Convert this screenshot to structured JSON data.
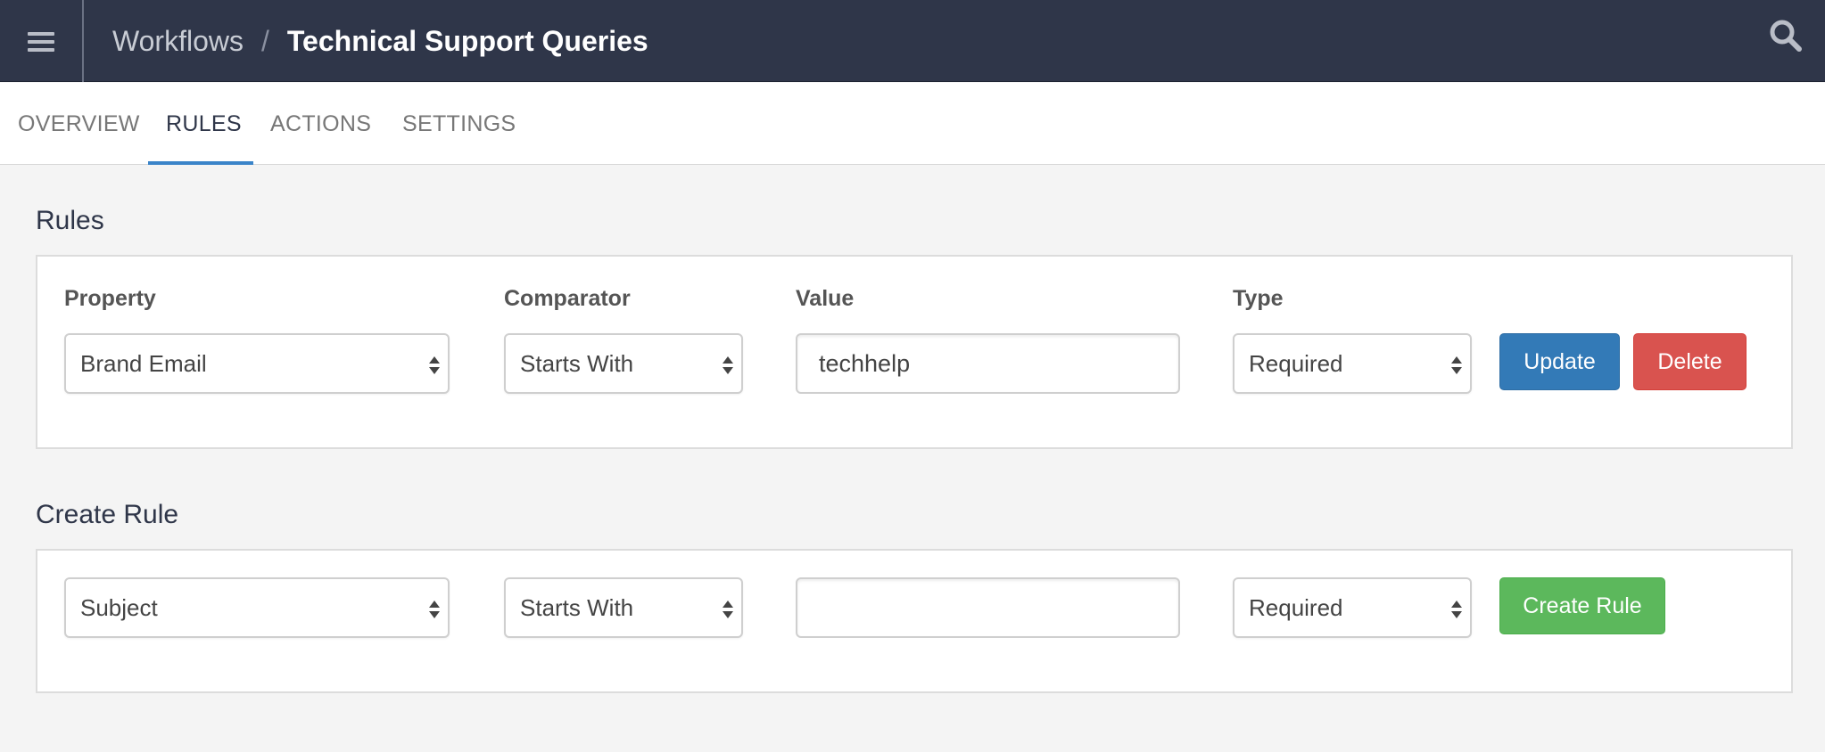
{
  "navbar": {
    "menu_icon": "hamburger-menu-icon",
    "breadcrumb_parent": "Workflows",
    "breadcrumb_separator": "/",
    "breadcrumb_current": "Technical Support Queries",
    "search_icon": "search-icon",
    "background_color": "#2f3649"
  },
  "tabs": [
    {
      "label": "OVERVIEW",
      "active": false
    },
    {
      "label": "RULES",
      "active": true
    },
    {
      "label": "ACTIONS",
      "active": false
    },
    {
      "label": "SETTINGS",
      "active": false
    }
  ],
  "rules_section": {
    "title": "Rules",
    "labels": {
      "property": "Property",
      "comparator": "Comparator",
      "value": "Value",
      "type": "Type"
    },
    "rule": {
      "property": "Brand Email",
      "comparator": "Starts With",
      "value": "techhelp",
      "type": "Required"
    },
    "update_label": "Update",
    "delete_label": "Delete"
  },
  "create_section": {
    "title": "Create Rule",
    "property": "Subject",
    "comparator": "Starts With",
    "value": "",
    "type": "Required",
    "create_label": "Create Rule"
  },
  "colors": {
    "accent": "#3a84c9",
    "update": "#337ab7",
    "delete": "#d9534f",
    "create": "#5cb85c"
  }
}
